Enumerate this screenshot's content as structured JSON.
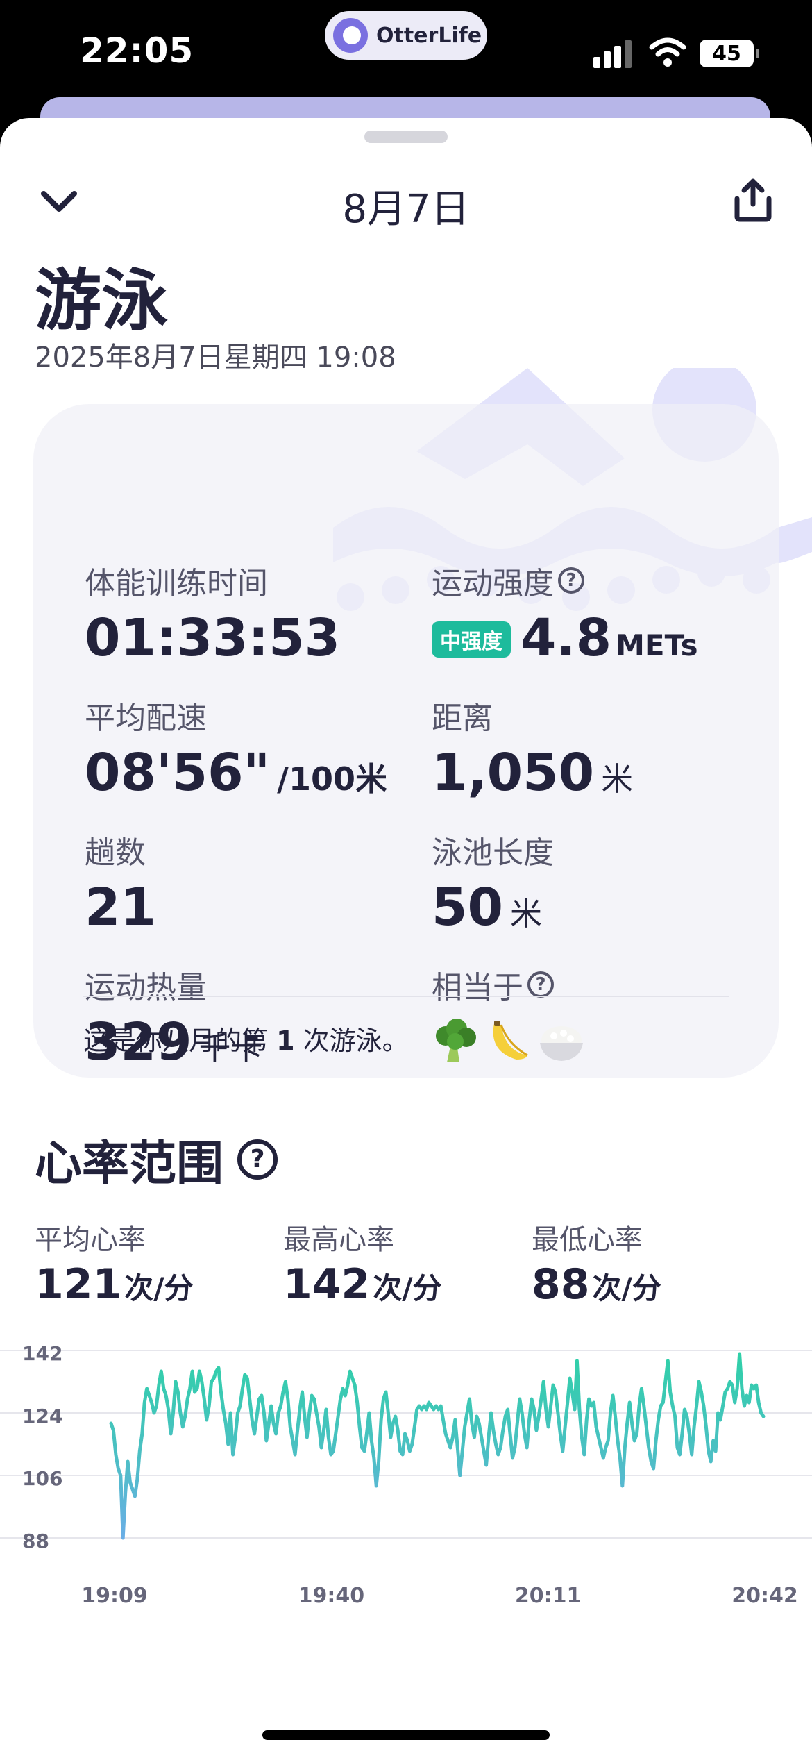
{
  "status_bar": {
    "time": "22:05",
    "app_name": "OtterLife",
    "battery": "45"
  },
  "nav": {
    "title": "8月7日"
  },
  "workout": {
    "title": "游泳",
    "datetime": "2025年8月7日星期四 19:08"
  },
  "stats": {
    "duration": {
      "label": "体能训练时间",
      "value": "01:33:53"
    },
    "intensity": {
      "label": "运动强度",
      "badge": "中强度",
      "value": "4.8",
      "unit": "METs"
    },
    "pace": {
      "label": "平均配速",
      "value": "08'56\"",
      "unit": "/100米"
    },
    "distance": {
      "label": "距离",
      "value": "1,050",
      "unit": "米"
    },
    "laps": {
      "label": "趟数",
      "value": "21"
    },
    "pool": {
      "label": "泳池长度",
      "value": "50",
      "unit": "米"
    },
    "calories": {
      "label": "运动热量",
      "value": "329",
      "unit": "千卡"
    },
    "equivalent": {
      "label": "相当于",
      "foods": [
        "broccoli-icon",
        "banana-icon",
        "rice-bowl-icon"
      ]
    },
    "note": {
      "prefix": "这是你八月的第",
      "count": "1",
      "suffix": "次游泳。"
    }
  },
  "heart_rate": {
    "title": "心率范围",
    "avg": {
      "label": "平均心率",
      "value": "121",
      "unit": "次/分"
    },
    "max": {
      "label": "最高心率",
      "value": "142",
      "unit": "次/分"
    },
    "min": {
      "label": "最低心率",
      "value": "88",
      "unit": "次/分"
    }
  },
  "chart_data": {
    "type": "line",
    "title": "",
    "xlabel": "",
    "ylabel": "",
    "y_ticks": [
      "142",
      "124",
      "106",
      "88"
    ],
    "x_ticks": [
      "19:09",
      "19:40",
      "20:11",
      "20:42"
    ],
    "ylim": [
      88,
      142
    ],
    "grid": true,
    "colors": {
      "high": "#2fd0a8",
      "low": "#6aaee6"
    },
    "series": [
      {
        "values": [
          121,
          119,
          112,
          108,
          106,
          88,
          101,
          110,
          104,
          102,
          100,
          105,
          113,
          118,
          127,
          131,
          129,
          127,
          124,
          126,
          132,
          136,
          131,
          129,
          125,
          118,
          124,
          133,
          130,
          124,
          120,
          123,
          128,
          131,
          136,
          130,
          131,
          136,
          133,
          128,
          122,
          126,
          133,
          134,
          136,
          137,
          130,
          125,
          121,
          115,
          124,
          112,
          117,
          124,
          126,
          131,
          135,
          134,
          128,
          122,
          118,
          123,
          128,
          129,
          124,
          116,
          121,
          126,
          121,
          118,
          124,
          126,
          130,
          133,
          128,
          120,
          116,
          112,
          119,
          125,
          130,
          123,
          117,
          124,
          129,
          128,
          124,
          120,
          114,
          119,
          125,
          117,
          112,
          113,
          118,
          123,
          128,
          131,
          129,
          132,
          136,
          134,
          132,
          127,
          120,
          114,
          113,
          118,
          124,
          116,
          111,
          103,
          110,
          122,
          128,
          130,
          124,
          117,
          121,
          123,
          119,
          113,
          112,
          118,
          116,
          113,
          115,
          120,
          125,
          126,
          125,
          126,
          125,
          127,
          126,
          125,
          126,
          125,
          126,
          122,
          118,
          116,
          114,
          117,
          122,
          114,
          106,
          113,
          120,
          124,
          128,
          121,
          117,
          123,
          121,
          117,
          113,
          109,
          117,
          124,
          119,
          115,
          112,
          114,
          119,
          123,
          125,
          118,
          111,
          114,
          121,
          128,
          124,
          118,
          114,
          122,
          128,
          125,
          119,
          123,
          128,
          133,
          125,
          120,
          126,
          132,
          130,
          124,
          118,
          113,
          120,
          127,
          134,
          130,
          125,
          139,
          125,
          117,
          112,
          122,
          128,
          126,
          127,
          120,
          117,
          114,
          111,
          114,
          116,
          124,
          129,
          123,
          116,
          111,
          103,
          114,
          121,
          127,
          121,
          116,
          118,
          126,
          131,
          126,
          120,
          114,
          110,
          108,
          116,
          122,
          126,
          127,
          133,
          139,
          130,
          126,
          123,
          114,
          112,
          118,
          125,
          123,
          118,
          112,
          120,
          126,
          133,
          130,
          126,
          120,
          113,
          110,
          116,
          113,
          124,
          122,
          126,
          130,
          131,
          133,
          132,
          127,
          131,
          141,
          131,
          126,
          129,
          127,
          132,
          131,
          132,
          127,
          124,
          123
        ]
      }
    ]
  }
}
